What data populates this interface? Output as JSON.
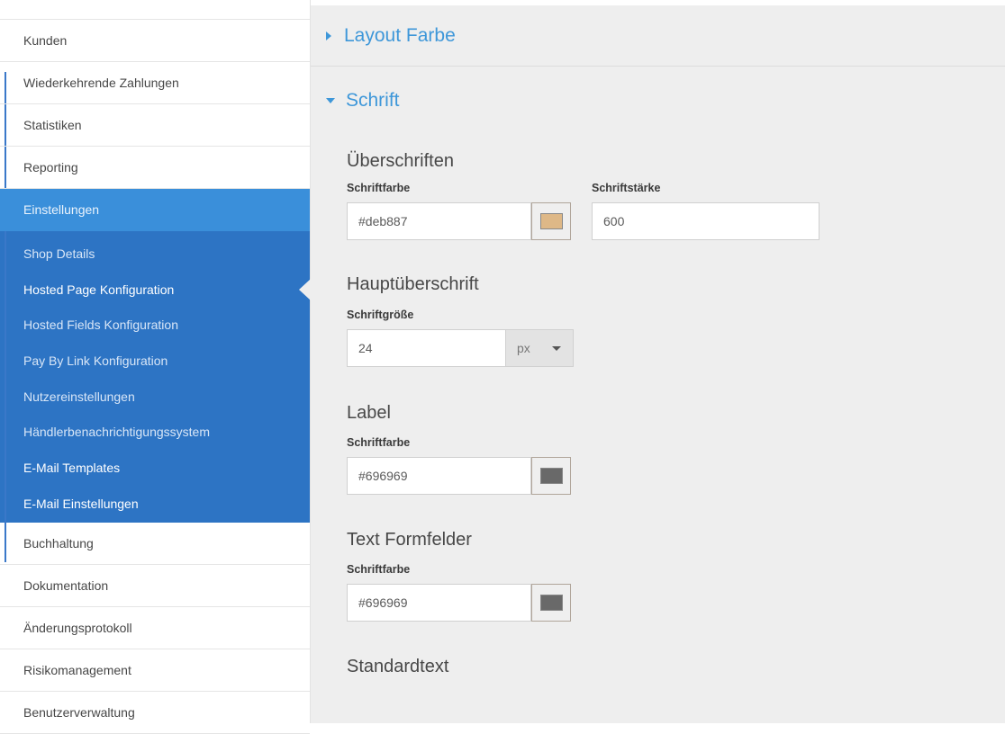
{
  "sidebar": {
    "items_before": [
      {
        "label": "Kunden"
      },
      {
        "label": "Wiederkehrende Zahlungen"
      },
      {
        "label": "Statistiken"
      },
      {
        "label": "Reporting"
      }
    ],
    "active": {
      "label": "Einstellungen"
    },
    "subitems": [
      {
        "label": "Shop Details"
      },
      {
        "label": "Hosted Page Konfiguration"
      },
      {
        "label": "Hosted Fields Konfiguration"
      },
      {
        "label": "Pay By Link Konfiguration"
      },
      {
        "label": "Nutzereinstellungen"
      },
      {
        "label": "Händlerbenachrichtigungssystem"
      },
      {
        "label": "E-Mail Templates"
      },
      {
        "label": "E-Mail Einstellungen"
      }
    ],
    "items_after": [
      {
        "label": "Buchhaltung"
      },
      {
        "label": "Dokumentation"
      },
      {
        "label": "Änderungsprotokoll"
      },
      {
        "label": "Risikomanagement"
      },
      {
        "label": "Benutzerverwaltung"
      }
    ]
  },
  "main": {
    "section_layout": {
      "title": "Layout Farbe"
    },
    "section_font": {
      "title": "Schrift"
    },
    "headings": {
      "title": "Überschriften",
      "color_label": "Schriftfarbe",
      "color_value": "#deb887",
      "swatch_color": "#deb887",
      "weight_label": "Schriftstärke",
      "weight_value": "600"
    },
    "main_heading": {
      "title": "Hauptüberschrift",
      "size_label": "Schriftgröße",
      "size_value": "24",
      "unit": "px"
    },
    "label": {
      "title": "Label",
      "color_label": "Schriftfarbe",
      "color_value": "#696969",
      "swatch_color": "#696969"
    },
    "text_fields": {
      "title": "Text Formfelder",
      "color_label": "Schriftfarbe",
      "color_value": "#696969",
      "swatch_color": "#696969"
    },
    "standard_text": {
      "title": "Standardtext"
    }
  },
  "colors": {
    "accent": "#3e97d9",
    "sidebar_active": "#3a8fda",
    "sidebar_sub": "#2d74c4"
  }
}
